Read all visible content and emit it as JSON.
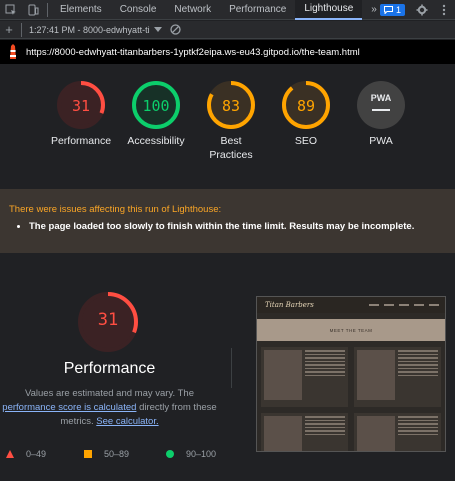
{
  "devtools": {
    "tabs": [
      "Elements",
      "Console",
      "Network",
      "Performance",
      "Lighthouse"
    ],
    "active_tab": "Lighthouse",
    "more_label": "»",
    "issues_count": "1"
  },
  "report_toolbar": {
    "session": "1:27:41 PM - 8000-edwhyatt-ti"
  },
  "url": "https://8000-edwhyatt-titanbarbers-1yptkf2eipa.ws-eu43.gitpod.io/the-team.html",
  "gauges": [
    {
      "label": "Performance",
      "value": "31",
      "score": 0.31,
      "color": "#ff4e42",
      "bg": "#3b2224"
    },
    {
      "label": "Accessibility",
      "value": "100",
      "score": 1.0,
      "color": "#0cce6b",
      "bg": "#173127"
    },
    {
      "label": "Best Practices",
      "value": "83",
      "score": 0.83,
      "color": "#ffa400",
      "bg": "#3a3024"
    },
    {
      "label": "SEO",
      "value": "89",
      "score": 0.89,
      "color": "#ffa400",
      "bg": "#3a3024"
    },
    {
      "label": "PWA",
      "value": "",
      "badge": "PWA",
      "score": 0,
      "color": "#e8eaed",
      "bg": "#424242"
    }
  ],
  "warning": {
    "title": "There were issues affecting this run of Lighthouse:",
    "items": [
      "The page loaded too slowly to finish within the time limit. Results may be incomplete."
    ]
  },
  "performance": {
    "score": "31",
    "score_fraction": 0.31,
    "title": "Performance",
    "desc_prefix": "Values are estimated and may vary. The",
    "link1": "performance score is calculated",
    "desc_middle": "directly from these metrics.",
    "link2": "See calculator."
  },
  "legend": [
    {
      "range": "0–49",
      "color": "#ff4e42",
      "shape": "triangle"
    },
    {
      "range": "50–89",
      "color": "#ffa400",
      "shape": "square"
    },
    {
      "range": "90–100",
      "color": "#0cce6b",
      "shape": "circle"
    }
  ],
  "screenshot": {
    "brand": "Titan Barbers",
    "banner": "MEET THE TEAM"
  }
}
